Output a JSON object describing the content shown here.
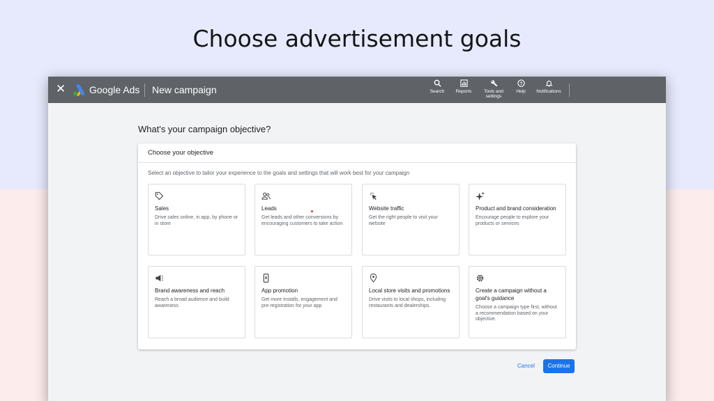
{
  "hero": {
    "title": "Choose advertisement goals"
  },
  "topbar": {
    "brand": "Google Ads",
    "page_title": "New campaign",
    "tools": [
      {
        "label": "Search",
        "icon": "search-icon"
      },
      {
        "label": "Reports",
        "icon": "reports-icon"
      },
      {
        "label": "Tools and settings",
        "icon": "wrench-icon"
      },
      {
        "label": "Help",
        "icon": "help-icon"
      },
      {
        "label": "Notifications",
        "icon": "bell-icon"
      }
    ]
  },
  "main": {
    "heading": "What's your campaign objective?",
    "card_title": "Choose your objective",
    "card_description": "Select an objective to tailor your experience to the goals and settings that will work best for your campaign",
    "objectives": [
      {
        "title": "Sales",
        "description": "Drive sales online, in app, by phone or in store",
        "icon": "tag-icon"
      },
      {
        "title": "Leads",
        "description": "Get leads and other conversions by encouraging customers to take action",
        "icon": "people-icon"
      },
      {
        "title": "Website traffic",
        "description": "Get the right people to visit your website",
        "icon": "cursor-click-icon"
      },
      {
        "title": "Product and brand consideration",
        "description": "Encourage people to explore your products or services",
        "icon": "sparkle-icon"
      },
      {
        "title": "Brand awareness and reach",
        "description": "Reach a broad audience and build awareness",
        "icon": "megaphone-icon"
      },
      {
        "title": "App promotion",
        "description": "Get more installs, engagement and pre-registration for your app",
        "icon": "phone-icon"
      },
      {
        "title": "Local store visits and promotions",
        "description": "Drive visits to local shops, including restaurants and dealerships.",
        "icon": "location-pin-icon"
      },
      {
        "title": "Create a campaign without a goal's guidance",
        "description": "Choose a campaign type first, without a recommendation based on your objective.",
        "icon": "gear-icon"
      }
    ]
  },
  "actions": {
    "cancel": "Cancel",
    "continue": "Continue"
  },
  "colors": {
    "accent": "#1a73e8",
    "topbar": "#5f6368"
  }
}
